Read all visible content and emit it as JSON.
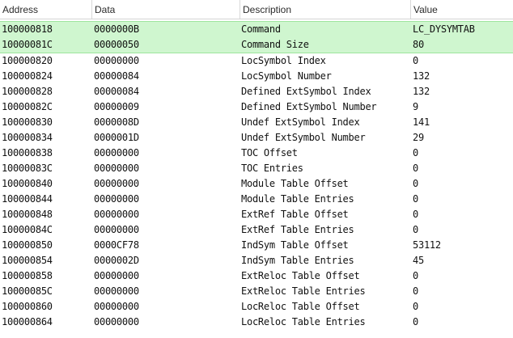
{
  "columns": {
    "address": "Address",
    "data": "Data",
    "description": "Description",
    "value": "Value"
  },
  "rows": [
    {
      "address": "100000818",
      "data": "0000000B",
      "description": "Command",
      "value": "LC_DYSYMTAB",
      "selected": true
    },
    {
      "address": "10000081C",
      "data": "00000050",
      "description": "Command Size",
      "value": "80",
      "selected": true
    },
    {
      "address": "100000820",
      "data": "00000000",
      "description": "LocSymbol Index",
      "value": "0"
    },
    {
      "address": "100000824",
      "data": "00000084",
      "description": "LocSymbol Number",
      "value": "132"
    },
    {
      "address": "100000828",
      "data": "00000084",
      "description": "Defined ExtSymbol Index",
      "value": "132"
    },
    {
      "address": "10000082C",
      "data": "00000009",
      "description": "Defined ExtSymbol Number",
      "value": "9"
    },
    {
      "address": "100000830",
      "data": "0000008D",
      "description": "Undef ExtSymbol Index",
      "value": "141"
    },
    {
      "address": "100000834",
      "data": "0000001D",
      "description": "Undef ExtSymbol Number",
      "value": "29"
    },
    {
      "address": "100000838",
      "data": "00000000",
      "description": "TOC Offset",
      "value": "0"
    },
    {
      "address": "10000083C",
      "data": "00000000",
      "description": "TOC Entries",
      "value": "0"
    },
    {
      "address": "100000840",
      "data": "00000000",
      "description": "Module Table Offset",
      "value": "0"
    },
    {
      "address": "100000844",
      "data": "00000000",
      "description": "Module Table Entries",
      "value": "0"
    },
    {
      "address": "100000848",
      "data": "00000000",
      "description": "ExtRef Table Offset",
      "value": "0"
    },
    {
      "address": "10000084C",
      "data": "00000000",
      "description": "ExtRef Table Entries",
      "value": "0"
    },
    {
      "address": "100000850",
      "data": "0000CF78",
      "description": "IndSym Table Offset",
      "value": "53112"
    },
    {
      "address": "100000854",
      "data": "0000002D",
      "description": "IndSym Table Entries",
      "value": "45"
    },
    {
      "address": "100000858",
      "data": "00000000",
      "description": "ExtReloc Table Offset",
      "value": "0"
    },
    {
      "address": "10000085C",
      "data": "00000000",
      "description": "ExtReloc Table Entries",
      "value": "0"
    },
    {
      "address": "100000860",
      "data": "00000000",
      "description": "LocReloc Table Offset",
      "value": "0"
    },
    {
      "address": "100000864",
      "data": "00000000",
      "description": "LocReloc Table Entries",
      "value": "0"
    }
  ],
  "colors": {
    "selection": "#cff6cf",
    "selection_edge": "#9ee59e",
    "header_separator": "#d8d8d8"
  }
}
